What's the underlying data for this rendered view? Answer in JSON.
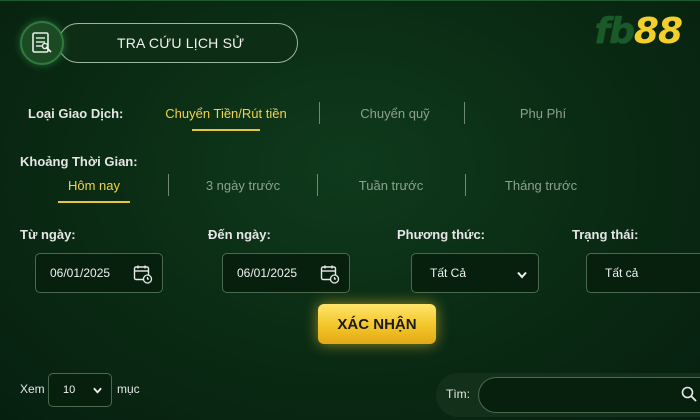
{
  "header": {
    "title": "TRA CỨU LỊCH SỬ",
    "logo_prefix": "fb",
    "logo_number": "88"
  },
  "transaction_type": {
    "label": "Loại Giao Dịch:",
    "tabs": [
      "Chuyển Tiền/Rút tiền",
      "Chuyển quỹ",
      "Phụ Phí"
    ],
    "active": "Chuyển Tiền/Rút tiền"
  },
  "time_range": {
    "label": "Khoảng Thời Gian:",
    "tabs": [
      "Hôm nay",
      "3 ngày trước",
      "Tuần trước",
      "Tháng trước"
    ],
    "active": "Hôm nay"
  },
  "filters": {
    "from_label": "Từ ngày:",
    "from_value": "06/01/2025",
    "to_label": "Đến ngày:",
    "to_value": "06/01/2025",
    "method_label": "Phương thức:",
    "method_value": "Tất Cả",
    "status_label": "Trạng thái:",
    "status_value": "Tất cả"
  },
  "confirm_label": "XÁC NHẬN",
  "paging": {
    "show_label": "Xem",
    "per_page": "10",
    "items_label": "mục"
  },
  "search": {
    "label": "Tìm:",
    "value": ""
  },
  "colors": {
    "accent": "#f2d24a",
    "background": "#0a2a13",
    "button": "#f3c52a"
  }
}
